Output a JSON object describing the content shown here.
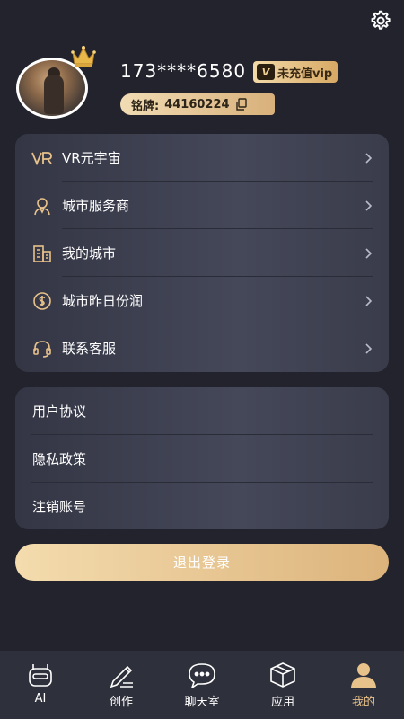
{
  "header": {
    "phone": "173****6580",
    "vip_label": "未充值vip",
    "vip_mark": "V",
    "badge_label": "铭牌:",
    "badge_value": "44160224"
  },
  "menu1": [
    {
      "label": "VR元宇宙",
      "icon": "vr-icon"
    },
    {
      "label": "城市服务商",
      "icon": "person-icon"
    },
    {
      "label": "我的城市",
      "icon": "building-icon"
    },
    {
      "label": "城市昨日份润",
      "icon": "dollar-coin-icon"
    },
    {
      "label": "联系客服",
      "icon": "headset-icon"
    }
  ],
  "menu2": [
    {
      "label": "用户协议"
    },
    {
      "label": "隐私政策"
    },
    {
      "label": "注销账号"
    }
  ],
  "logout_label": "退出登录",
  "tabs": [
    {
      "label": "AI",
      "icon": "robot-icon",
      "active": false
    },
    {
      "label": "创作",
      "icon": "pen-icon",
      "active": false
    },
    {
      "label": "聊天室",
      "icon": "chat-bubble-icon",
      "active": false
    },
    {
      "label": "应用",
      "icon": "box-icon",
      "active": false
    },
    {
      "label": "我的",
      "icon": "user-icon",
      "active": true
    }
  ],
  "colors": {
    "background": "#22232c",
    "accent_gold": "#e8c28b",
    "card": "#3d3f50",
    "tabbar": "#2e303b"
  }
}
